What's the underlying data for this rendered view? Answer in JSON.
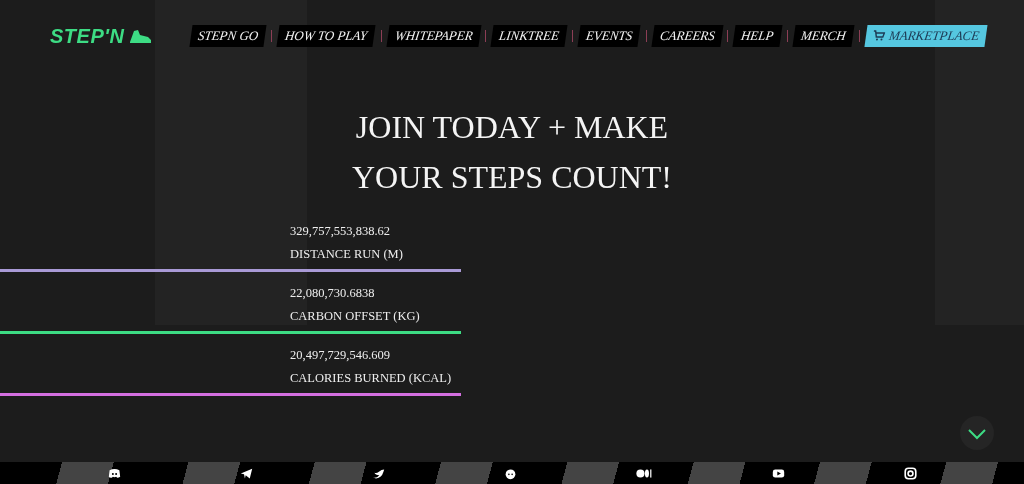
{
  "logo": {
    "text": "STEP'N"
  },
  "nav": [
    {
      "label": "STEPN GO",
      "kind": "link"
    },
    {
      "label": "HOW TO PLAY",
      "kind": "link"
    },
    {
      "label": "WHITEPAPER",
      "kind": "link"
    },
    {
      "label": "LINKTREE",
      "kind": "link"
    },
    {
      "label": "EVENTS",
      "kind": "link"
    },
    {
      "label": "CAREERS",
      "kind": "link"
    },
    {
      "label": "HELP",
      "kind": "link"
    },
    {
      "label": "MERCH",
      "kind": "link"
    },
    {
      "label": "MARKETPLACE",
      "kind": "cta"
    }
  ],
  "headline": [
    "JOIN TODAY + MAKE",
    "YOUR STEPS COUNT!"
  ],
  "stats": [
    {
      "value": "329,757,553,838.62",
      "label": "DISTANCE RUN (M)",
      "color": "#a99ad6"
    },
    {
      "value": "22,080,730.6838",
      "label": "CARBON OFFSET (KG)",
      "color": "#3ddc84"
    },
    {
      "value": "20,497,729,546.609",
      "label": "CALORIES BURNED (KCAL)",
      "color": "#d46fe0"
    }
  ]
}
